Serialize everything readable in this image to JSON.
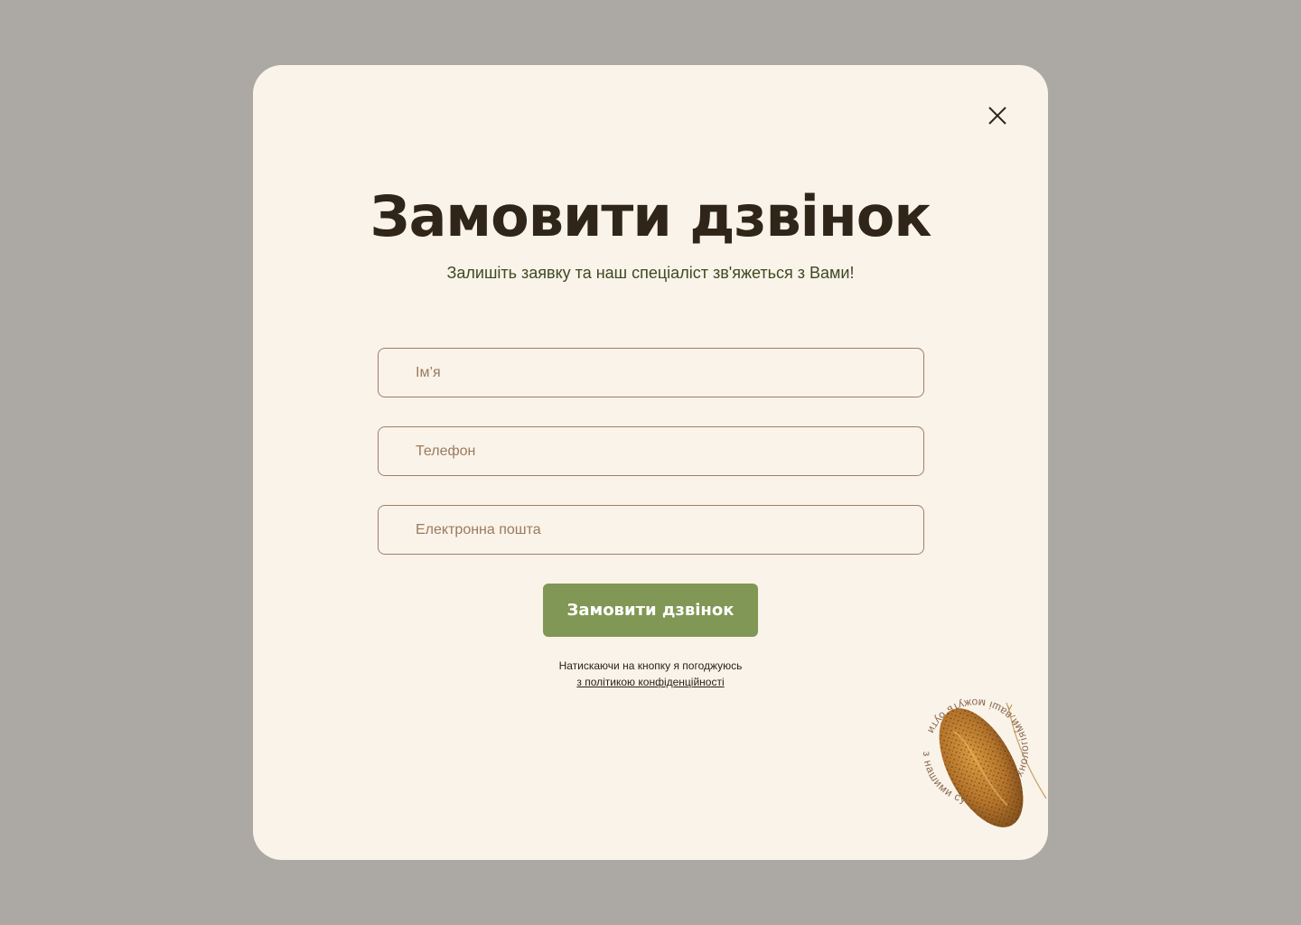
{
  "modal": {
    "close_label": "close",
    "title": "Замовити дзвінок",
    "subtitle": "Залишіть заявку та наш спеціаліст зв'яжеться з Вами!",
    "fields": {
      "name_placeholder": "Ім’я",
      "phone_placeholder": "Телефон",
      "email_placeholder": "Електронна пошта"
    },
    "submit_label": "Замовити дзвінок",
    "consent_text": "Натискаючи на кнопку я погоджуюсь",
    "policy_link": "з політикою конфіденційності",
    "decor_circle_text": "з нашими сучасними технологіями ваші можуть бути"
  },
  "colors": {
    "backdrop": "#aca8a4",
    "modal_bg": "#faf3e9",
    "title": "#2f2518",
    "subtitle": "#3d4a22",
    "accent_button": "#819755",
    "field_border": "#a0806a"
  }
}
